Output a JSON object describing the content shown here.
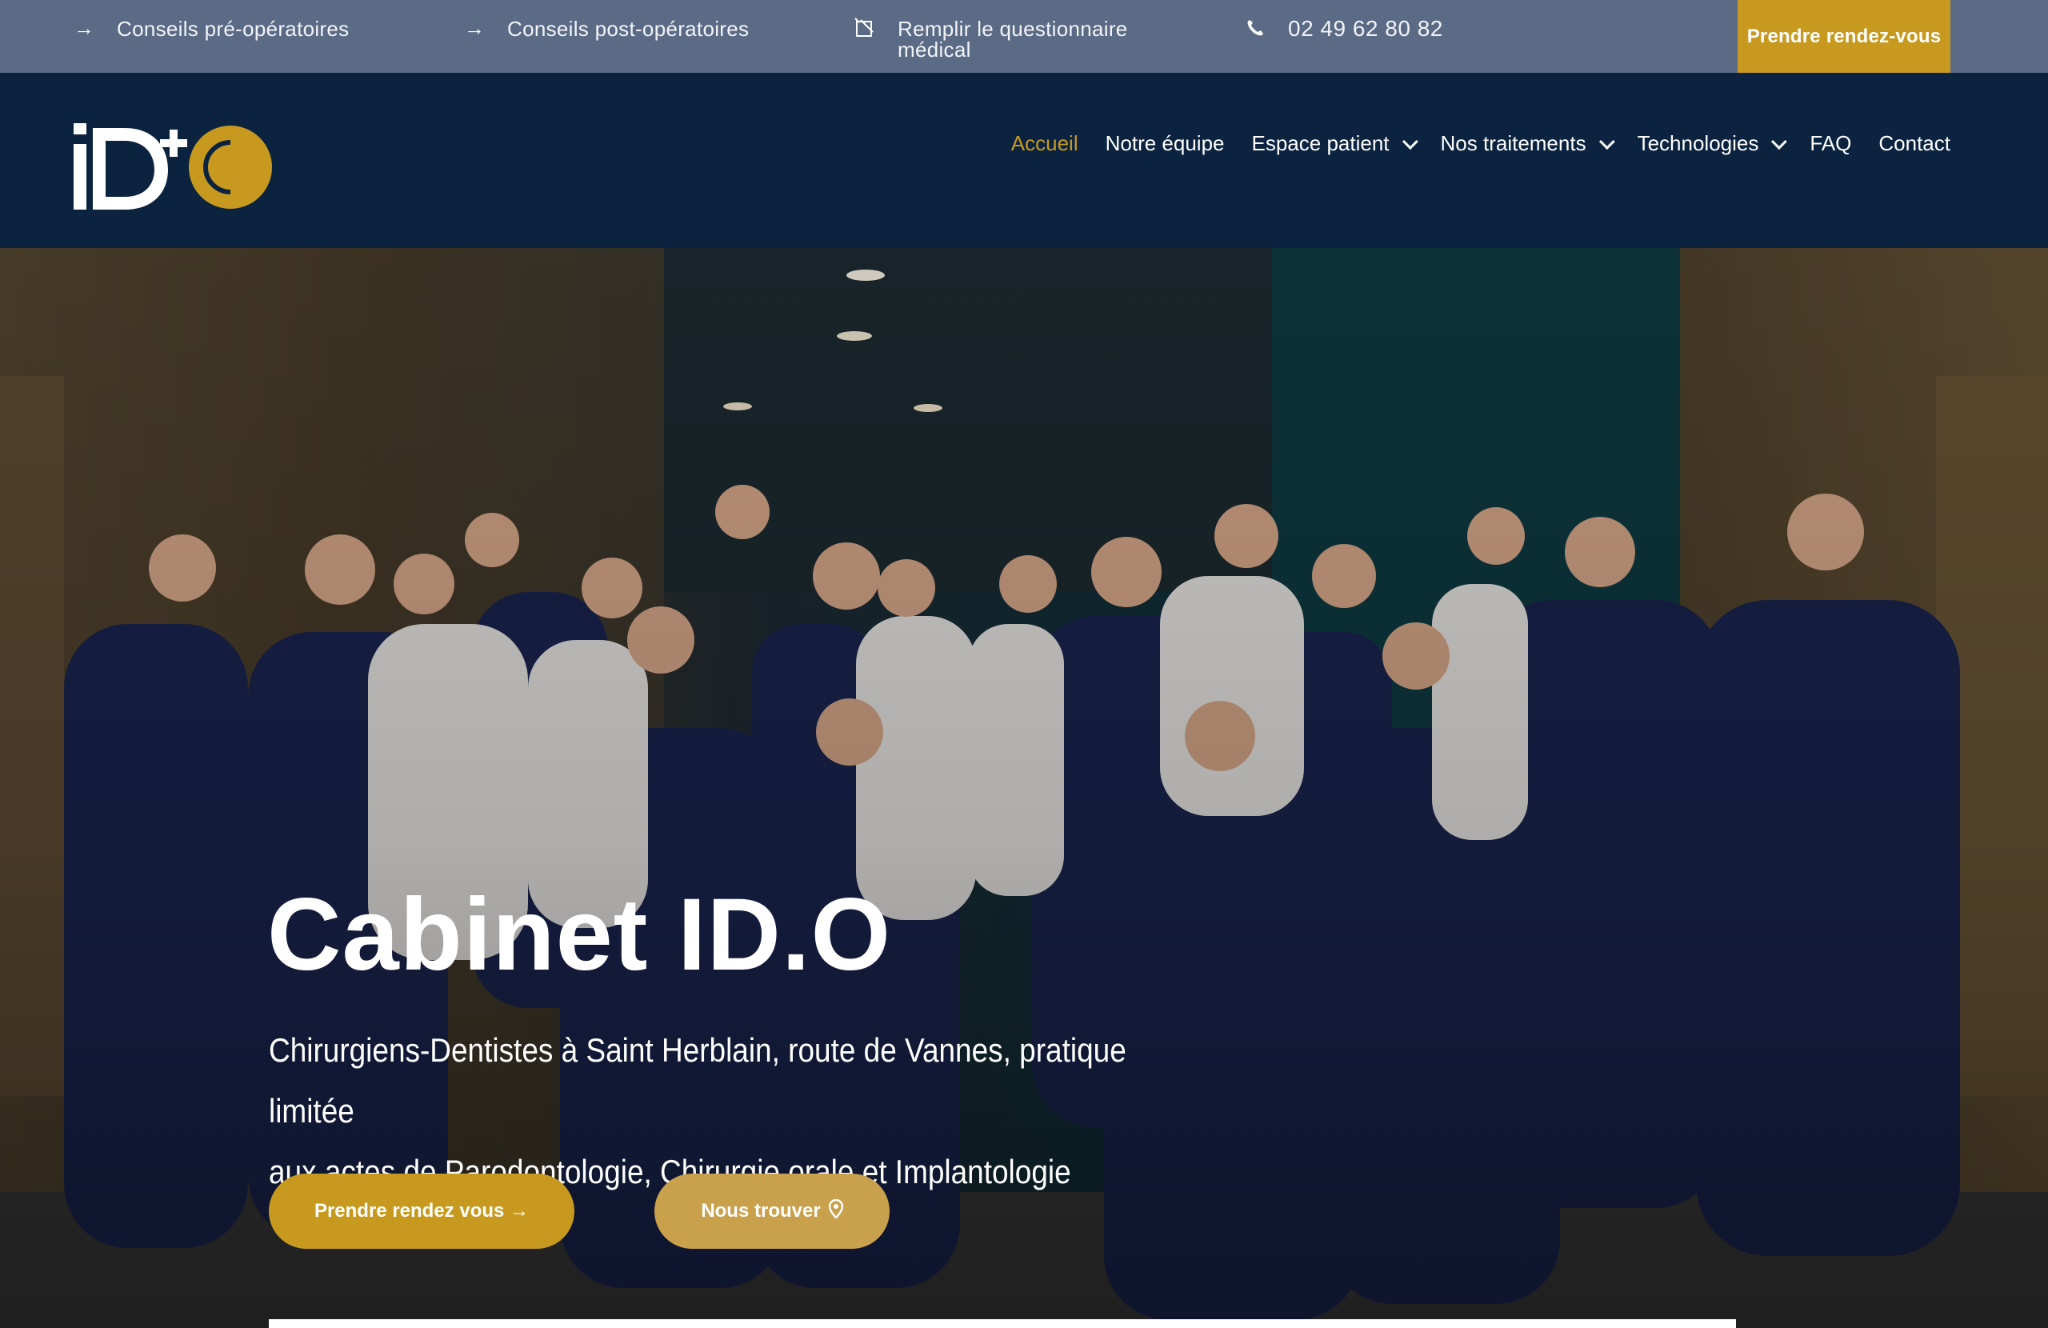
{
  "topbar": {
    "items": [
      {
        "icon": "arrow-right-icon",
        "label": "Conseils pré-opératoires"
      },
      {
        "icon": "arrow-right-icon",
        "label": "Conseils post-opératoires"
      },
      {
        "icon": "form-icon",
        "label_line1": "Remplir le questionnaire",
        "label_line2": "médical"
      },
      {
        "icon": "phone-icon",
        "label": "02 49 62 80 82"
      }
    ],
    "cta_label": "Prendre rendez-vous"
  },
  "header": {
    "logo_text": "ID+O",
    "nav": [
      {
        "label": "Accueil",
        "active": true,
        "dropdown": false
      },
      {
        "label": "Notre équipe",
        "active": false,
        "dropdown": false
      },
      {
        "label": "Espace patient",
        "active": false,
        "dropdown": true
      },
      {
        "label": "Nos traitements",
        "active": false,
        "dropdown": true
      },
      {
        "label": "Technologies",
        "active": false,
        "dropdown": true
      },
      {
        "label": "FAQ",
        "active": false,
        "dropdown": false
      },
      {
        "label": "Contact",
        "active": false,
        "dropdown": false
      }
    ]
  },
  "hero": {
    "title": "Cabinet ID.O",
    "subtitle_line1": "Chirurgiens-Dentistes à Saint Herblain, route de Vannes, pratique limitée",
    "subtitle_line2": "aux actes de Parodontologie, Chirurgie orale et Implantologie",
    "button_primary": "Prendre rendez vous →",
    "button_secondary": "Nous trouver",
    "image_icon": "team-photo"
  },
  "colors": {
    "navy": "#0c2340",
    "topbar": "#5b6b85",
    "gold": "#c79a1f",
    "gold_light": "#c9a04b"
  }
}
